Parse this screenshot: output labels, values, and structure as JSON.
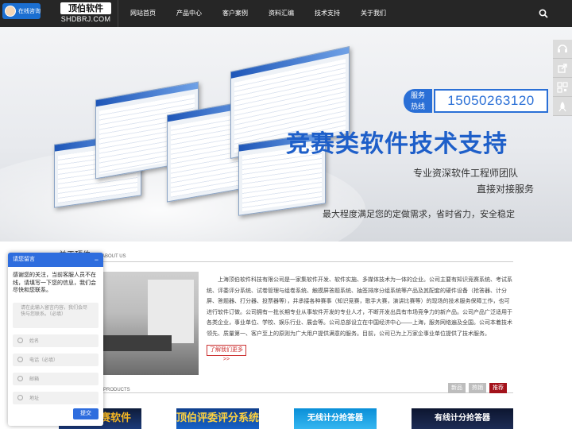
{
  "topbar": {
    "chat_badge": "在线咨询",
    "logo_main": "顶伯软件",
    "logo_sub": "SHDBRJ.COM",
    "nav": [
      "网站首页",
      "产品中心",
      "客户案例",
      "资料汇编",
      "技术支持",
      "关于我们"
    ],
    "search_icon": "search-icon"
  },
  "banner": {
    "hotline_label_1": "服务",
    "hotline_label_2": "热线",
    "hotline_number": "15050263120",
    "slogan": "竞赛类软件技术支持",
    "tagline_1": "专业资深软件工程师团队",
    "tagline_2": "直接对接服务",
    "tagline_3": "最大程度满足您的定做需求，省时省力，安全稳定"
  },
  "float_bar": [
    "headset-icon",
    "share-icon",
    "qrcode-icon",
    "rocket-icon"
  ],
  "about": {
    "title": "关于顶伯",
    "title_en": "ABOUT US",
    "text": "上海顶伯软件科技有限公司是一家集软件开发、软件实施、多媒体技术为一体的企业。公司主要有知识竞赛系统、考试系统、评委评分系统、试卷管理与组卷系统、触摸屏答题系统、抽签排序分组系统等产品及其配套的硬件设备（抢答器、计分屏、答题器、打分器、投票器等），并承接各种赛事（知识竞赛，歌手大赛，演讲比赛等）的现场的技术服务保障工作，也可进行软件订做。公司拥有一批长期专业从事软件开发的专业人才，不断开发出具有市场竞争力的新产品。公司产品广泛适用于各类企业，事业单位、学校、娱乐行业、展会等。公司总部设立在中国经济中心——上海，服务网络遍及全国。公司本着技术领先、质量第一、客户至上的原则为广大用户提供满意的服务。目前，公司已为上万家企事业单位提供了技术服务。",
    "more": "了解我们更多>>"
  },
  "products": {
    "title_en": "PRODUCTS",
    "tabs": [
      "新品",
      "热销",
      "推荐"
    ],
    "thumbs": [
      "知识竞赛软件",
      "顶伯评委评分系统",
      "无线计分抢答器",
      "有线计分抢答器"
    ]
  },
  "chat": {
    "title": "请您留言",
    "minimize": "−",
    "message": "感谢您的关注，当前客服人员不在线，请填写一下您的信息，我们会尽快和您联系。",
    "textarea_placeholder": "请在此输入留言内容，我们会尽快与您联系。（必填）",
    "fields": [
      "姓名",
      "电话（必填）",
      "邮箱",
      "地址"
    ],
    "submit": "提交"
  },
  "colors": {
    "nav_bg": "#262626",
    "accent_blue": "#2e6dde",
    "accent_red": "#a3121b"
  }
}
